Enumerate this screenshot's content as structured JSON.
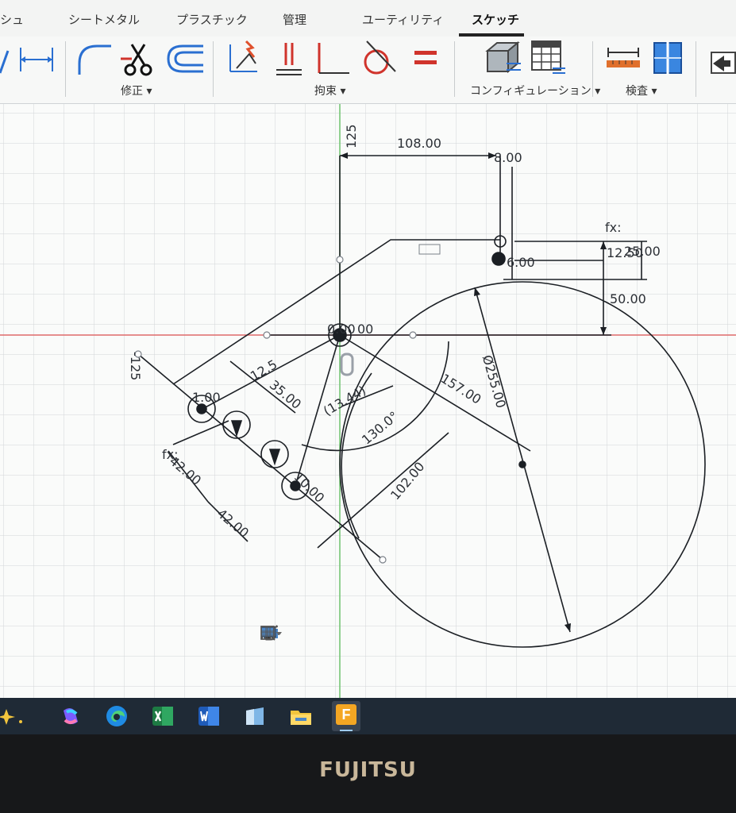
{
  "ribbon": {
    "tabs": [
      {
        "label": "シュ"
      },
      {
        "label": "シートメタル"
      },
      {
        "label": "プラスチック"
      },
      {
        "label": "管理"
      },
      {
        "label": "ユーティリティ"
      },
      {
        "label": "スケッチ",
        "active": true
      }
    ],
    "groups": {
      "modify": "修正 ▾",
      "constraints": "拘束 ▾",
      "configuration": "コンフィギュレーション ▾",
      "inspect": "検査 ▾"
    }
  },
  "sketch": {
    "axis_label_top": "125",
    "axis_label_left": "-125",
    "dimensions": {
      "d108": "108.00",
      "d8": "8.00",
      "d12_50": "12.50",
      "d25": "25.00",
      "d50": "50.00",
      "d6": "6.00",
      "fx_right": "fx:",
      "circle_dia": "Ø255.00",
      "d157": "157.00",
      "angle130": "130.0°",
      "d102": "102.00",
      "d42a": "42.00",
      "d42b": "42.00",
      "fx_left": "fx:",
      "d12_5": "12.5",
      "d35": "35.00",
      "d13": "(13.44)",
      "d10": "10.00",
      "d00": "00",
      "d1": "1.00",
      "dcenter": "0.00"
    }
  },
  "taskbar": {
    "apps": [
      "copilot-icon",
      "edge-icon",
      "excel-icon",
      "word-icon",
      "store-icon",
      "explorer-icon",
      "fusion-icon"
    ],
    "fusion_label": "F"
  },
  "bezel": {
    "brand": "FUJITSU"
  },
  "colors": {
    "grid": "#d3d6d8",
    "sketch_line": "#1b1f24",
    "x_axis": "#e06a6a",
    "y_axis": "#6ec26e",
    "taskbar": "#1f2a36"
  }
}
